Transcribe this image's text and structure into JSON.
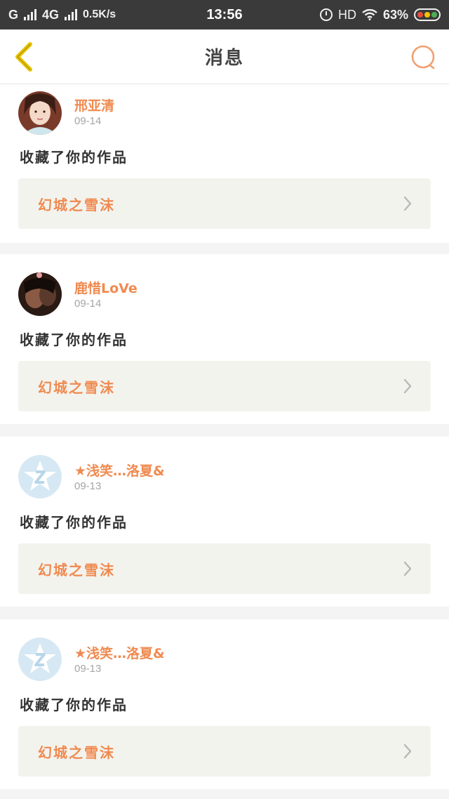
{
  "status_bar": {
    "carrier1": "G",
    "carrier2": "4G",
    "speed": "0.5K/s",
    "time": "13:56",
    "hd": "HD",
    "battery": "63%"
  },
  "header": {
    "title": "消息"
  },
  "notifications": [
    {
      "username": "邢亚清",
      "date": "09-14",
      "action": "收藏了你的作品",
      "work_title": "幻城之雪沫",
      "avatar_type": "photo-light"
    },
    {
      "username": "鹿惜LoVe",
      "date": "09-14",
      "action": "收藏了你的作品",
      "work_title": "幻城之雪沫",
      "avatar_type": "photo-dark"
    },
    {
      "username": "★浅笑…洛夏&",
      "date": "09-13",
      "action": "收藏了你的作品",
      "work_title": "幻城之雪沫",
      "avatar_type": "default-star"
    },
    {
      "username": "★浅笑…洛夏&",
      "date": "09-13",
      "action": "收藏了你的作品",
      "work_title": "幻城之雪沫",
      "avatar_type": "default-star"
    }
  ],
  "colors": {
    "accent": "#f08a50",
    "back_arrow": "#e8c400",
    "link_bg": "#f3f3ee"
  }
}
